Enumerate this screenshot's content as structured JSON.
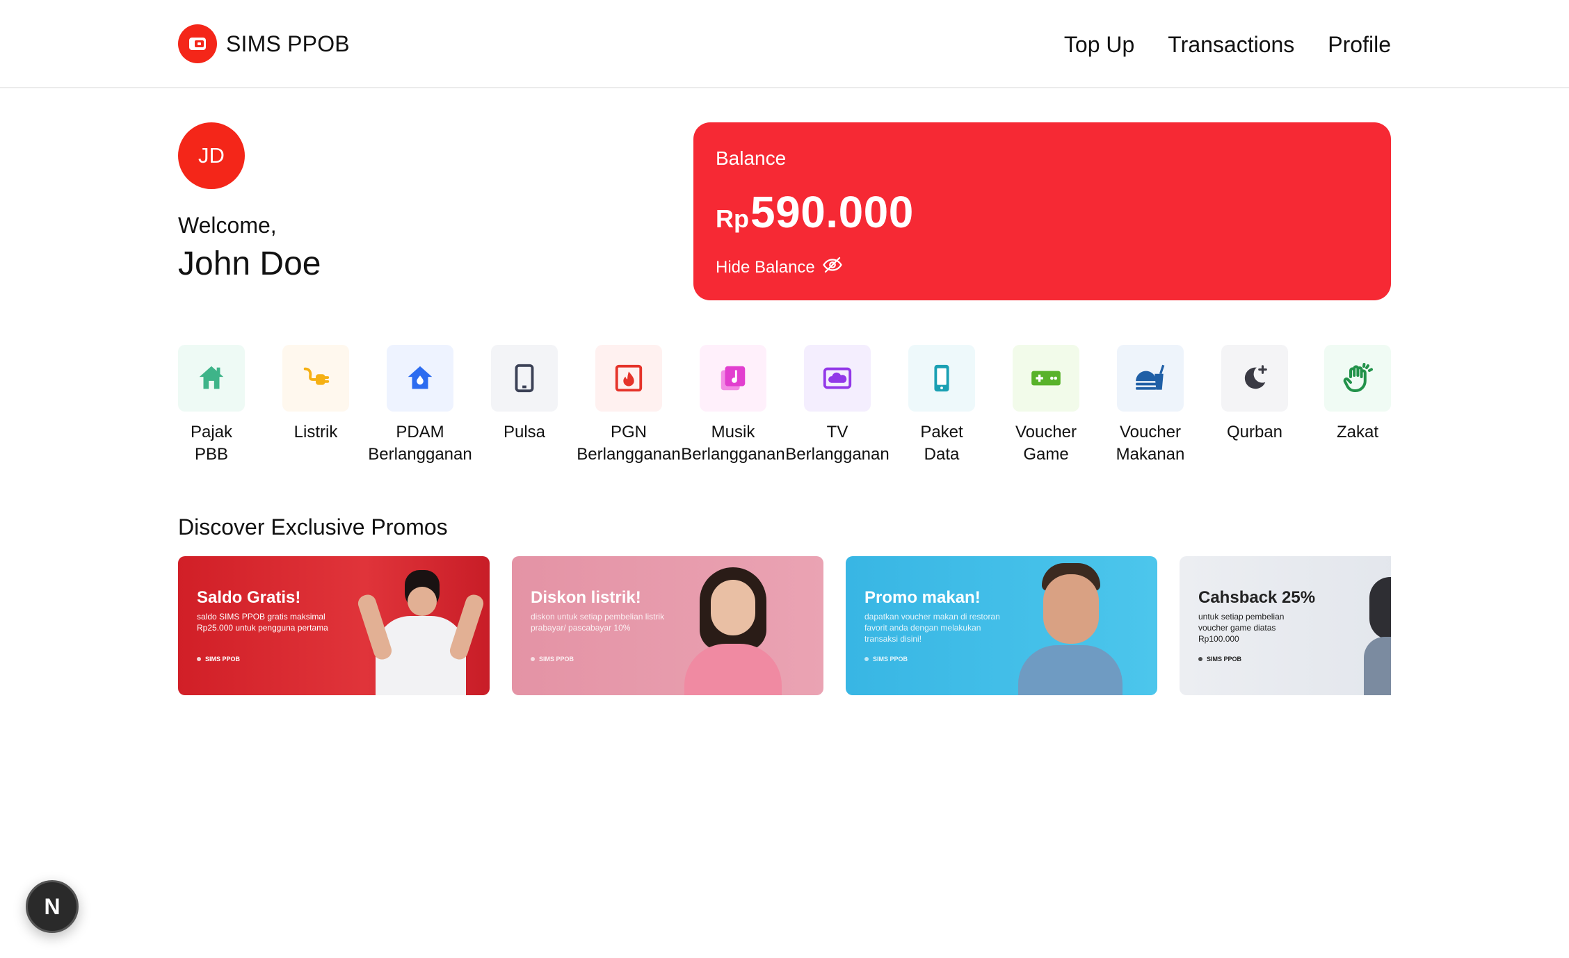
{
  "header": {
    "brand": "SIMS PPOB",
    "nav": [
      "Top Up",
      "Transactions",
      "Profile"
    ]
  },
  "profile": {
    "initials": "JD",
    "welcome": "Welcome,",
    "name": "John Doe"
  },
  "balance": {
    "label": "Balance",
    "currency": "Rp",
    "amount": "590.000",
    "hide_label": "Hide Balance",
    "hide_icon": "eye-off-icon"
  },
  "services": [
    {
      "label": "Pajak\nPBB",
      "icon": "house-icon",
      "bg": "#eefaf5",
      "color": "#3eb489"
    },
    {
      "label": "Listrik",
      "icon": "plug-icon",
      "bg": "#fff8ee",
      "color": "#f5b014"
    },
    {
      "label": "PDAM\nBerlangganan",
      "icon": "water-house-icon",
      "bg": "#eef3ff",
      "color": "#2d6cf0"
    },
    {
      "label": "Pulsa",
      "icon": "phone-icon",
      "bg": "#f3f4f7",
      "color": "#3b4156"
    },
    {
      "label": "PGN\nBerlangganan",
      "icon": "fire-icon",
      "bg": "#fff1f0",
      "color": "#e5332a"
    },
    {
      "label": "Musik\nBerlangganan",
      "icon": "music-icon",
      "bg": "#fff0fb",
      "color": "#e23fcf"
    },
    {
      "label": "TV\nBerlangganan",
      "icon": "tv-icon",
      "bg": "#f4eefe",
      "color": "#9238e8"
    },
    {
      "label": "Paket\nData",
      "icon": "mobile-icon",
      "bg": "#eef9fb",
      "color": "#1aa0b3"
    },
    {
      "label": "Voucher\nGame",
      "icon": "gamepad-icon",
      "bg": "#f2fbea",
      "color": "#58b22a"
    },
    {
      "label": "Voucher\nMakanan",
      "icon": "food-icon",
      "bg": "#eef4fb",
      "color": "#1f5fa6"
    },
    {
      "label": "Qurban",
      "icon": "moon-icon",
      "bg": "#f4f4f6",
      "color": "#3a3a44"
    },
    {
      "label": "Zakat",
      "icon": "hand-icon",
      "bg": "#f0fbf4",
      "color": "#22924a"
    }
  ],
  "promos": {
    "title": "Discover Exclusive Promos",
    "items": [
      {
        "title": "Saldo Gratis!",
        "desc": "saldo SIMS PPOB gratis maksimal Rp25.000 untuk pengguna pertama",
        "brand": "SIMS PPOB",
        "bg": "#d8232d",
        "text_color": "#ffffff"
      },
      {
        "title": "Diskon listrik!",
        "desc": "diskon untuk setiap pembelian listrik prabayar/ pascabayar 10%",
        "brand": "SIMS PPOB",
        "bg": "#e99bab",
        "text_color": "#ffffff"
      },
      {
        "title": "Promo makan!",
        "desc": "dapatkan voucher makan di restoran favorit anda dengan melakukan transaksi disini!",
        "brand": "SIMS PPOB",
        "bg": "#3fbfe6",
        "text_color": "#ffffff"
      },
      {
        "title": "Cahsback 25%",
        "desc": "untuk setiap pembelian voucher game diatas Rp100.000",
        "brand": "SIMS PPOB",
        "bg": "#e7eaef",
        "text_color": "#222222"
      }
    ]
  },
  "dev_badge": "N"
}
